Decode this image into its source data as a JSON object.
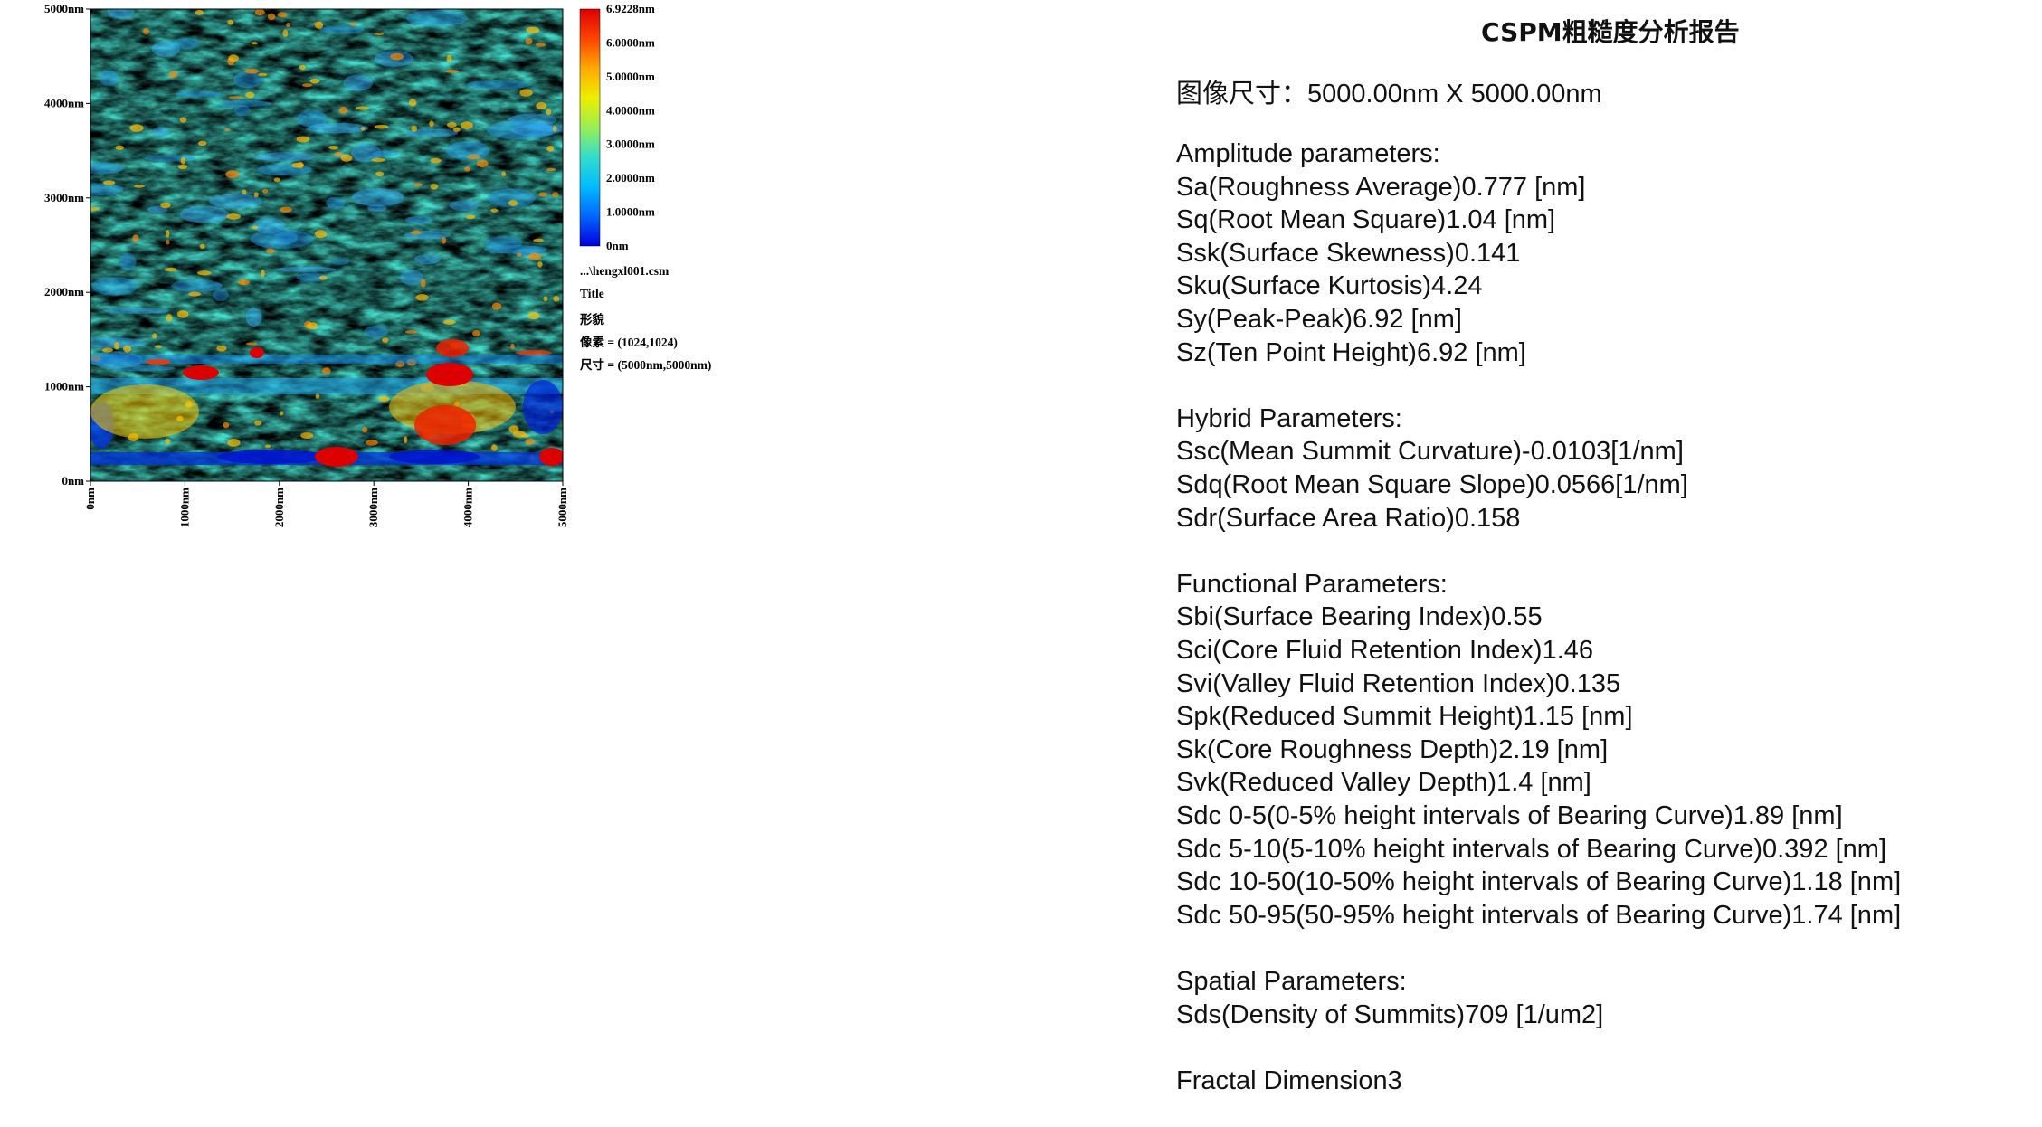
{
  "colorbar": {
    "labels": [
      "6.9228nm",
      "6.0000nm",
      "5.0000nm",
      "4.0000nm",
      "3.0000nm",
      "2.0000nm",
      "1.0000nm",
      "0nm"
    ],
    "colors": [
      "#0000dd",
      "#0066ff",
      "#00bbff",
      "#33ddcc",
      "#99ee55",
      "#eeee00",
      "#ffaa00",
      "#ff4400",
      "#dd0000"
    ]
  },
  "y_axis": {
    "ticks": [
      "5000nm",
      "4000nm",
      "3000nm",
      "2000nm",
      "1000nm",
      "0nm"
    ]
  },
  "x_axis": {
    "ticks": [
      "0nm",
      "1000nm",
      "2000nm",
      "3000nm",
      "4000nm",
      "5000nm"
    ]
  },
  "info": {
    "file": "...\\hengxl001.csm",
    "title": "Title",
    "mode": "形貌",
    "pixels": "像素 = (1024,1024)",
    "size": "尺寸 = (5000nm,5000nm)"
  },
  "report": {
    "title": "CSPM粗糙度分析报告",
    "image_size": "图像尺寸：5000.00nm X 5000.00nm",
    "lines": [
      "Amplitude parameters:",
      "Sa(Roughness Average)0.777 [nm]",
      "Sq(Root Mean Square)1.04  [nm]",
      "Ssk(Surface Skewness)0.141",
      "Sku(Surface Kurtosis)4.24",
      "Sy(Peak-Peak)6.92  [nm]",
      "Sz(Ten Point Height)6.92  [nm]",
      "",
      "Hybrid Parameters:",
      "Ssc(Mean Summit Curvature)-0.0103[1/nm]",
      "Sdq(Root Mean Square Slope)0.0566[1/nm]",
      "Sdr(Surface Area Ratio)0.158",
      "",
      "Functional Parameters:",
      "Sbi(Surface Bearing Index)0.55",
      "Sci(Core Fluid Retention Index)1.46",
      "Svi(Valley Fluid Retention Index)0.135",
      "Spk(Reduced Summit Height)1.15  [nm]",
      "Sk(Core Roughness Depth)2.19  [nm]",
      "Svk(Reduced Valley Depth)1.4   [nm]",
      "Sdc 0-5(0-5% height intervals of Bearing Curve)1.89  [nm]",
      "Sdc 5-10(5-10% height intervals of Bearing Curve)0.392 [nm]",
      "Sdc 10-50(10-50% height intervals of Bearing Curve)1.18  [nm]",
      "Sdc 50-95(50-95% height intervals of Bearing Curve)1.74  [nm]",
      "",
      "Spatial Parameters:",
      "Sds(Density of Summits)709   [1/um2]",
      "",
      "Fractal Dimension3"
    ]
  }
}
